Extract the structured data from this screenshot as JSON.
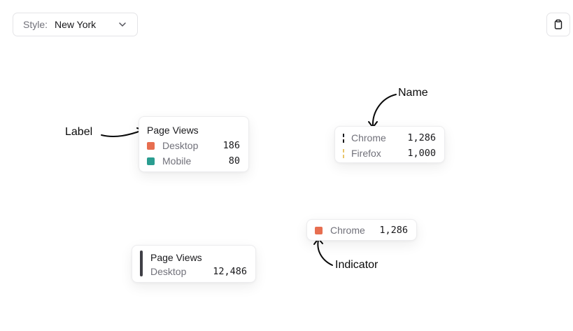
{
  "toolbar": {
    "style_label": "Style:",
    "style_value": "New York",
    "chevron_icon": "chevron-down-icon",
    "copy_icon": "clipboard-icon"
  },
  "annotations": {
    "label": "Label",
    "name": "Name",
    "indicator": "Indicator"
  },
  "card_label": {
    "title": "Page Views",
    "rows": [
      {
        "label": "Desktop",
        "value": "186",
        "color": "#e76e50"
      },
      {
        "label": "Mobile",
        "value": "80",
        "color": "#2a9d90"
      }
    ]
  },
  "card_name": {
    "rows": [
      {
        "label": "Chrome",
        "value": "1,286",
        "color": "#18181b"
      },
      {
        "label": "Firefox",
        "value": "1,000",
        "color": "#e8c468"
      }
    ]
  },
  "card_indicator": {
    "label": "Chrome",
    "value": "1,286",
    "color": "#e76e50"
  },
  "card_line": {
    "title": "Page Views",
    "label": "Desktop",
    "value": "12,486",
    "color": "#3f3f46"
  }
}
